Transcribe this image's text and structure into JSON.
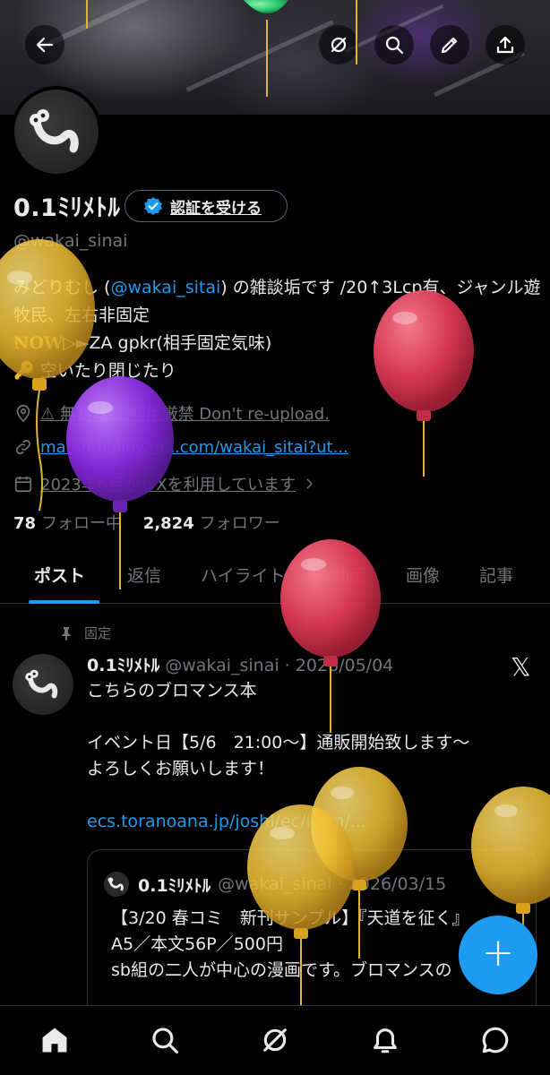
{
  "colors": {
    "accent": "#1d9bf0",
    "text_primary": "#e7e9ea",
    "text_secondary": "#71767b",
    "background": "#000000",
    "balloon_yellow": "#f2c233",
    "balloon_red": "#e03a57",
    "balloon_purple": "#8a2be2",
    "balloon_green": "#2ecc71"
  },
  "header": {
    "back_icon": "arrow-left-icon",
    "actions": [
      "grok-icon",
      "search-icon",
      "edit-icon",
      "share-icon"
    ]
  },
  "profile": {
    "display_name": "0.1ﾐﾘﾒﾄﾙ",
    "verify_label": "認証を受ける",
    "handle": "@wakai_sinai",
    "bio_line1_pre": "みどりむし (",
    "bio_mention": "@wakai_sitai",
    "bio_line1_post": ") の雑談垢です /20↑3Lcp有、ジャンル遊牧民、左右非固定",
    "bio_now": "NOW",
    "bio_line3_rest": "▷►ZA gpkr(相手固定気味)",
    "bio_line4": "🔑 空いたり閉じたり",
    "location": "⚠ 無断転載,利用厳禁 Don't re-upload.",
    "website": "marshmallow-qa.com/wakai_sitai?ut...",
    "joined": "2023年6月からXを利用しています",
    "following_count": "78",
    "following_label": "フォロー中",
    "followers_count": "2,824",
    "followers_label": "フォロワー"
  },
  "tabs": [
    {
      "label": "ポスト",
      "active": true
    },
    {
      "label": "返信",
      "active": false
    },
    {
      "label": "ハイライト",
      "active": false
    },
    {
      "label": "動画",
      "active": false
    },
    {
      "label": "画像",
      "active": false
    },
    {
      "label": "記事",
      "active": false
    }
  ],
  "post": {
    "pinned_label": "固定",
    "author": "0.1ﾐﾘﾒﾄﾙ",
    "handle_date": "@wakai_sinai · 2026/05/04",
    "text": "こちらのブロマンス本\n\nイベント日【5/6　21:00～】通販開始致します～\nよろしくお願いします！",
    "link": "ecs.toranoana.jp/joshi/ec/item/...",
    "quote": {
      "author": "0.1ﾐﾘﾒﾄﾙ",
      "handle_date": "@wakai_sinai · 2026/03/15",
      "text": "【3/20 春コミ　新刊サンプル】『天道を征く』\nA5／本文56P／500円\nsb組の二人が中心の漫画です。ブロマンスの"
    }
  },
  "fab": {
    "label": "+"
  },
  "bottom_nav": [
    "home-icon",
    "search-icon",
    "grok-icon",
    "notifications-icon",
    "messages-icon"
  ]
}
